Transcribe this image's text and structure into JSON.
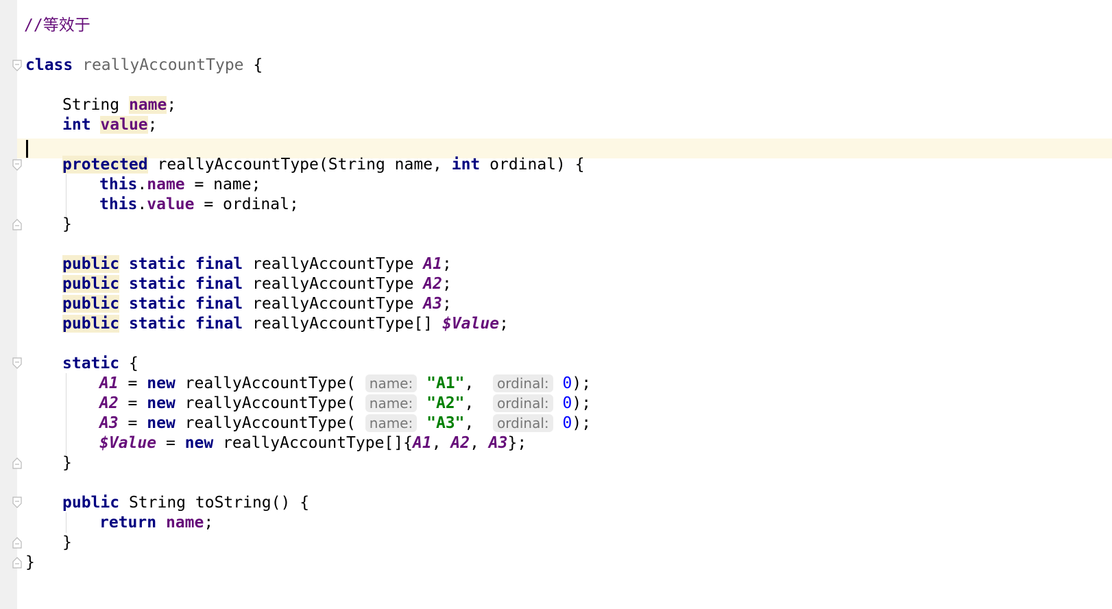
{
  "editor": {
    "language": "Java",
    "comment": "//等效于",
    "class_kw": "class",
    "class_name": "reallyAccountType",
    "open_brace": "{",
    "close_brace": "}",
    "semicolon": ";",
    "fields": {
      "type_string": "String",
      "name": "name",
      "type_int": "int",
      "value": "value"
    },
    "constructor": {
      "modifier": "protected",
      "signature": " reallyAccountType(String name, ",
      "int_kw": "int",
      "params_end": " ordinal) {",
      "this_kw": "this",
      "dot": ".",
      "assign_name": " = name;",
      "assign_value": " = ordinal;",
      "close": "}"
    },
    "declarations": {
      "public": "public",
      "static": "static",
      "final": "final",
      "type": "reallyAccountType",
      "array_type": "reallyAccountType[]",
      "names": [
        "A1",
        "A2",
        "A3",
        "$Value"
      ]
    },
    "static_block": {
      "static_kw": "static",
      "open": " {",
      "new_kw": "new",
      "ctor_call": " reallyAccountType(",
      "hint_name": "name:",
      "hint_ordinal": "ordinal:",
      "args": [
        {
          "var": "A1",
          "name": "\"A1\"",
          "ordinal": "0"
        },
        {
          "var": "A2",
          "name": "\"A2\"",
          "ordinal": "0"
        },
        {
          "var": "A3",
          "name": "\"A3\"",
          "ordinal": "0"
        }
      ],
      "array_assign_var": "$Value",
      "array_init_open": " reallyAccountType[]{",
      "array_items": [
        "A1",
        "A2",
        "A3"
      ],
      "array_init_close": "};",
      "close": "}"
    },
    "to_string": {
      "modifier": "public",
      "signature": " String toString() {",
      "return_kw": "return",
      "return_field": "name",
      "close": "}"
    }
  },
  "colors": {
    "keyword": "#000080",
    "field": "#660e7a",
    "string": "#008000",
    "number": "#0000ff",
    "caret_line": "#fdf8e4",
    "gutter": "#f0f0f0"
  }
}
